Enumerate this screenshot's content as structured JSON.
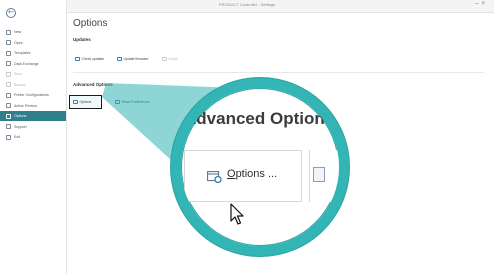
{
  "window": {
    "title": "PRODUCT Controller - Settings"
  },
  "sidebar": {
    "back_icon": "back-arrow-icon",
    "items": [
      {
        "label": "New",
        "icon": "new-file-icon",
        "state": "normal"
      },
      {
        "label": "Open",
        "icon": "open-folder-icon",
        "state": "normal"
      },
      {
        "label": "Templates",
        "icon": "templates-icon",
        "state": "normal"
      },
      {
        "label": "Data Exchange",
        "icon": "data-exchange-icon",
        "state": "normal"
      },
      {
        "label": "Save",
        "icon": "save-icon",
        "state": "disabled"
      },
      {
        "label": "Backup",
        "icon": "backup-icon",
        "state": "disabled"
      },
      {
        "label": "Printer Configurations",
        "icon": "printer-icon",
        "state": "normal"
      },
      {
        "label": "Active Printers",
        "icon": "active-printers-icon",
        "state": "normal"
      },
      {
        "label": "Options",
        "icon": "options-icon",
        "state": "selected"
      },
      {
        "label": "Support",
        "icon": "support-icon",
        "state": "normal"
      },
      {
        "label": "Exit",
        "icon": "exit-icon",
        "state": "normal"
      }
    ]
  },
  "page": {
    "title": "Options",
    "updates": {
      "title": "Updates",
      "buttons": [
        {
          "label": "Check updates",
          "icon": "refresh-icon",
          "state": "normal"
        },
        {
          "label": "Update firmware",
          "icon": "firmware-icon",
          "state": "normal"
        },
        {
          "label": "Install",
          "icon": "install-icon",
          "state": "disabled"
        }
      ]
    },
    "advanced": {
      "title": "Advanced Options",
      "buttons": [
        {
          "label": "Options",
          "icon": "options-window-icon",
          "state": "highlighted"
        },
        {
          "label": "Reset Preferences",
          "icon": "reset-icon",
          "state": "normal"
        }
      ]
    }
  },
  "magnifier": {
    "heading": "Advanced Options",
    "button_label_underlined": "O",
    "button_label_rest": "ptions ...",
    "cursor_icon": "mouse-pointer-icon"
  },
  "colors": {
    "accent": "#2f7f8d",
    "magnifier_ring": "#32b5b4",
    "icon_blue": "#3b7ea8"
  }
}
